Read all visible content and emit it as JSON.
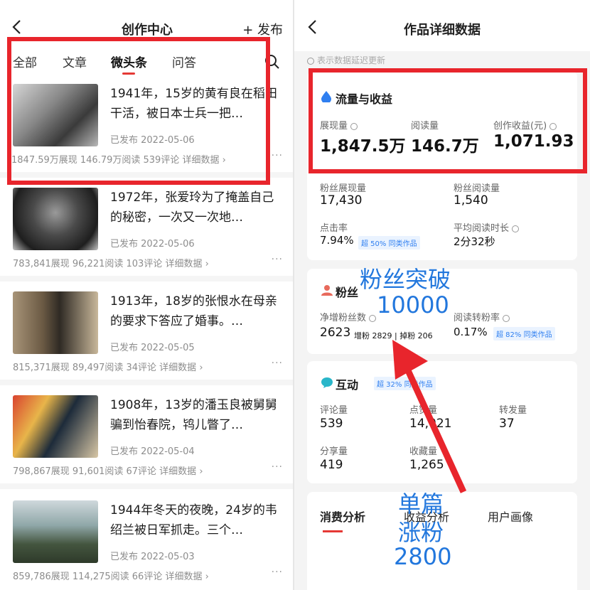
{
  "left": {
    "header": {
      "title": "创作中心",
      "publish": "+ 发布"
    },
    "tabs": [
      "全部",
      "文章",
      "微头条",
      "问答"
    ],
    "articles": [
      {
        "title": "1941年，15岁的黄有良在稻田干活，被日本士兵一把…",
        "status": "已发布  2022-05-06",
        "stats": "1847.59万展现  146.79万阅读  539评论  详细数据 ›"
      },
      {
        "title": "1972年，张爱玲为了掩盖自己的秘密，一次又一次地…",
        "status": "已发布  2022-05-06",
        "stats": "783,841展现  96,221阅读  103评论  详细数据 ›"
      },
      {
        "title": "1913年，18岁的张恨水在母亲的要求下答应了婚事。…",
        "status": "已发布  2022-05-05",
        "stats": "815,371展现  89,497阅读  34评论  详细数据 ›"
      },
      {
        "title": "1908年，13岁的潘玉良被舅舅骗到怡春院，鸨儿瞥了…",
        "status": "已发布  2022-05-04",
        "stats": "798,867展现  91,601阅读  67评论  详细数据 ›"
      },
      {
        "title": "1944年冬天的夜晚，24岁的韦绍兰被日军抓走。三个…",
        "status": "已发布  2022-05-03",
        "stats": "859,786展现  114,275阅读  66评论  详细数据 ›"
      }
    ],
    "more": "···"
  },
  "right": {
    "header": {
      "title": "作品详细数据"
    },
    "note": "表示数据延迟更新",
    "flow": {
      "title": "流量与收益",
      "metrics": [
        {
          "label": "展现量",
          "value": "1,847.5万"
        },
        {
          "label": "阅读量",
          "value": "146.7万"
        },
        {
          "label": "创作收益(元)",
          "value": "1,071.93"
        }
      ],
      "fan_views_label": "粉丝展现量",
      "fan_views": "17,430",
      "fan_reads_label": "粉丝阅读量",
      "fan_reads": "1,540",
      "ctr_label": "点击率",
      "ctr": "7.94%",
      "ctr_badge": "超 50% 同类作品",
      "avg_time_label": "平均阅读时长",
      "avg_time": "2分32秒"
    },
    "fans": {
      "title": "粉丝",
      "net_label": "净增粉丝数",
      "net": "2623",
      "detail": "增粉 2829 | 掉粉 206",
      "conv_label": "阅读转粉率",
      "conv": "0.17%",
      "conv_badge": "超 82% 同类作品"
    },
    "interact": {
      "title": "互动",
      "badge": "超 32% 同类作品",
      "metrics": [
        {
          "label": "评论量",
          "value": "539"
        },
        {
          "label": "点赞量",
          "value": "14,021"
        },
        {
          "label": "转发量",
          "value": "37"
        },
        {
          "label": "分享量",
          "value": "419"
        },
        {
          "label": "收藏量",
          "value": "1,265"
        }
      ]
    },
    "tabs": [
      "消费分析",
      "收益分析",
      "用户画像"
    ]
  },
  "annotations": {
    "fans_break": "粉丝突破",
    "fans_count": "10000",
    "single_line1": "单篇",
    "single_line2": "涨粉",
    "single_line3": "2800"
  },
  "colors": {
    "accent_red": "#e53935",
    "annotation_box": "#e8252c",
    "annotation_text": "#2277dd",
    "badge_blue": "#2f7ff0"
  }
}
